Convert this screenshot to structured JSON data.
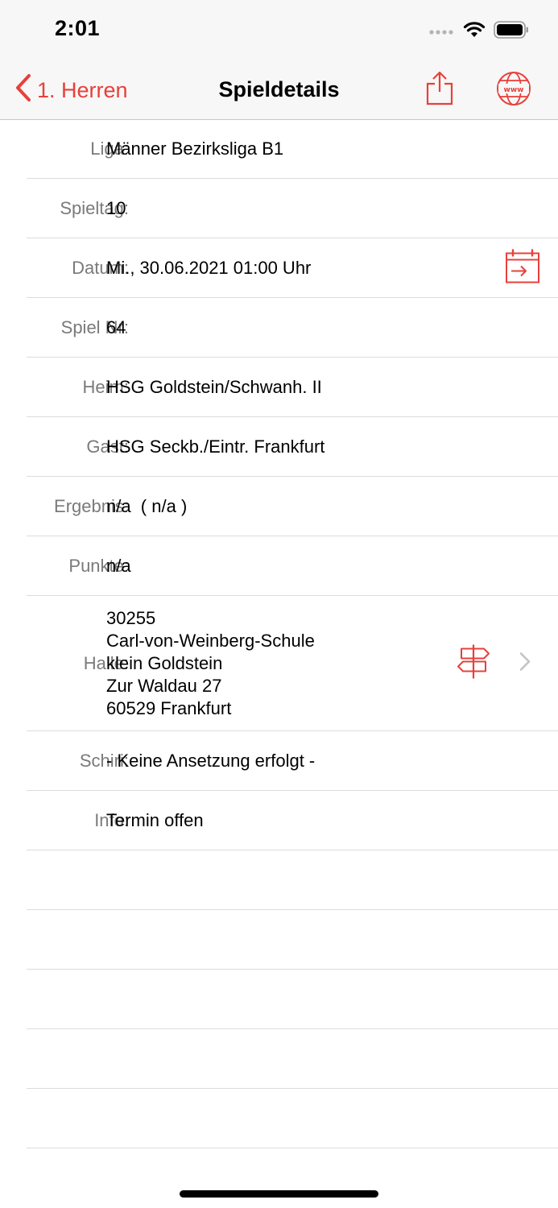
{
  "status_bar": {
    "time": "2:01",
    "icons": [
      "signal-dots-icon",
      "wifi-icon",
      "battery-icon"
    ]
  },
  "nav": {
    "back_label": "1. Herren",
    "title": "Spieldetails",
    "accent_color": "#e8403a"
  },
  "details": {
    "liga": {
      "label": "Liga:",
      "value": "Männer Bezirksliga B1"
    },
    "spieltag": {
      "label": "Spieltag:",
      "value": "10"
    },
    "datum": {
      "label": "Datum:",
      "value": "Mi., 30.06.2021 01:00 Uhr"
    },
    "spiel_nr": {
      "label": "Spiel Nr:",
      "value": "64"
    },
    "heim": {
      "label": "Heim:",
      "value": "HSG Goldstein/Schwanh. II"
    },
    "gast": {
      "label": "Gast:",
      "value": "HSG Seckb./Eintr. Frankfurt"
    },
    "ergebnis": {
      "label": "Ergebnis:",
      "value": "n/a  ( n/a )"
    },
    "punkte": {
      "label": "Punkte:",
      "value": "n/a"
    },
    "halle": {
      "label": "Halle:",
      "value": "30255\nCarl-von-Weinberg-Schule\nklein Goldstein\nZur Waldau 27\n60529 Frankfurt"
    },
    "schiri": {
      "label": "Schiri:",
      "value": "- Keine Ansetzung erfolgt -"
    },
    "info": {
      "label": "Info:",
      "value": "Termin offen"
    }
  }
}
